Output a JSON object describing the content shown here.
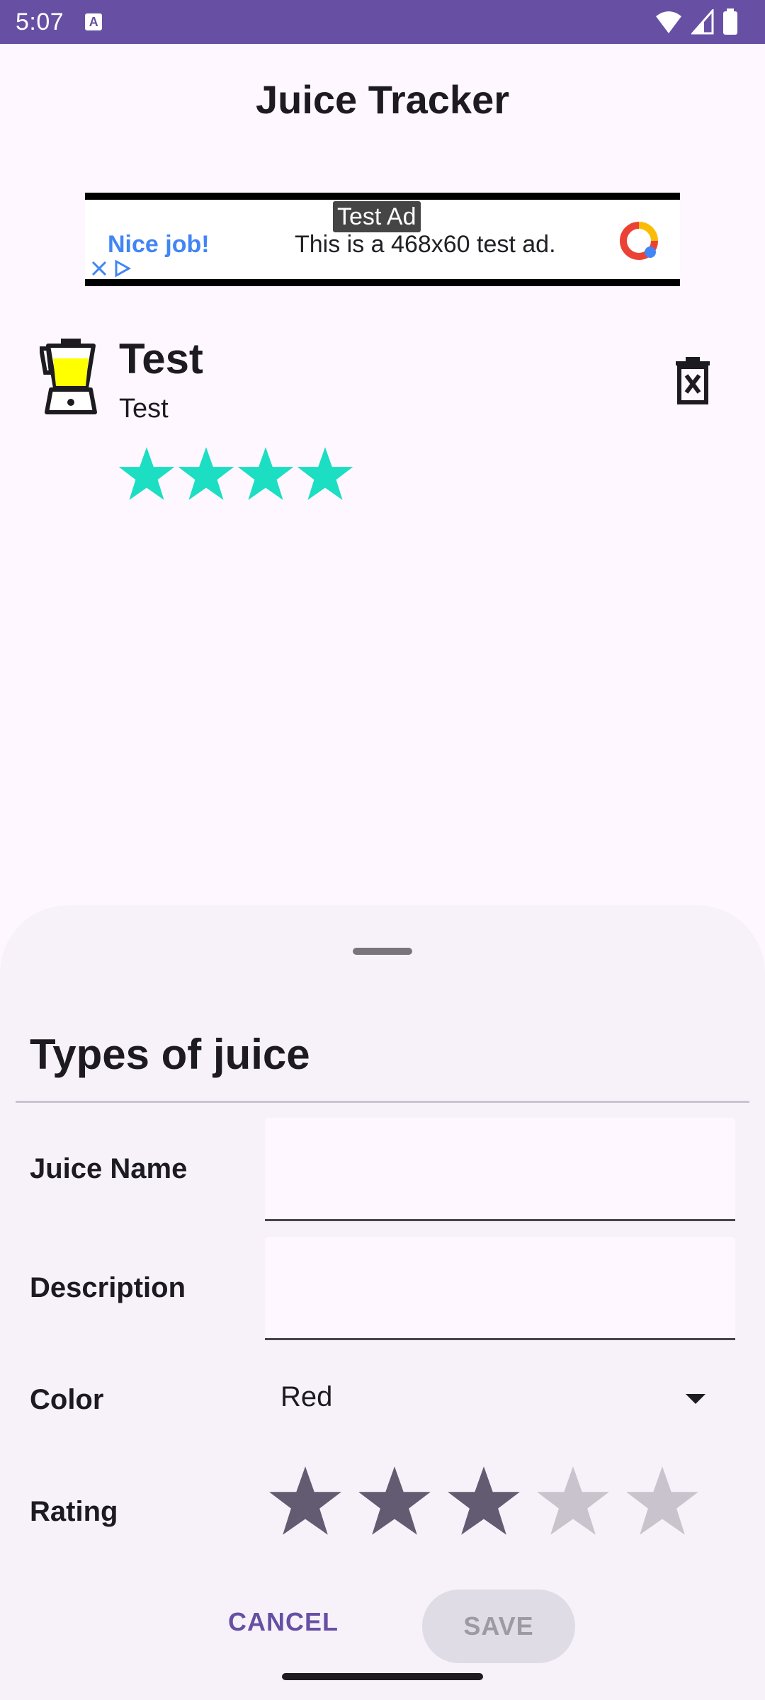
{
  "status_bar": {
    "time": "5:07",
    "notification_icon": "text-a-icon",
    "icons": [
      "wifi-icon",
      "signal-icon",
      "battery-icon"
    ]
  },
  "app_bar": {
    "title": "Juice Tracker"
  },
  "ad": {
    "badge": "Test Ad",
    "headline": "Nice job!",
    "body": "This is a 468x60 test ad.",
    "icons": [
      "ad-logo-icon",
      "close-icon",
      "adchoices-icon"
    ]
  },
  "juice_list": [
    {
      "name": "Test",
      "description": "Test",
      "rating": 4,
      "color": "#FFFF00",
      "icon": "juice-blender-icon",
      "delete_icon": "delete-icon"
    }
  ],
  "sheet": {
    "title": "Types of juice",
    "fields": {
      "name_label": "Juice Name",
      "name_value": "",
      "description_label": "Description",
      "description_value": "",
      "color_label": "Color",
      "color_value": "Red",
      "rating_label": "Rating",
      "rating_value": 3,
      "rating_max": 5
    },
    "cancel_label": "CANCEL",
    "save_label": "SAVE"
  },
  "colors": {
    "primary": "#6750A4",
    "star_list": "#1BDEC2",
    "star_filled": "#625B71",
    "star_empty": "#C8C3CC"
  }
}
